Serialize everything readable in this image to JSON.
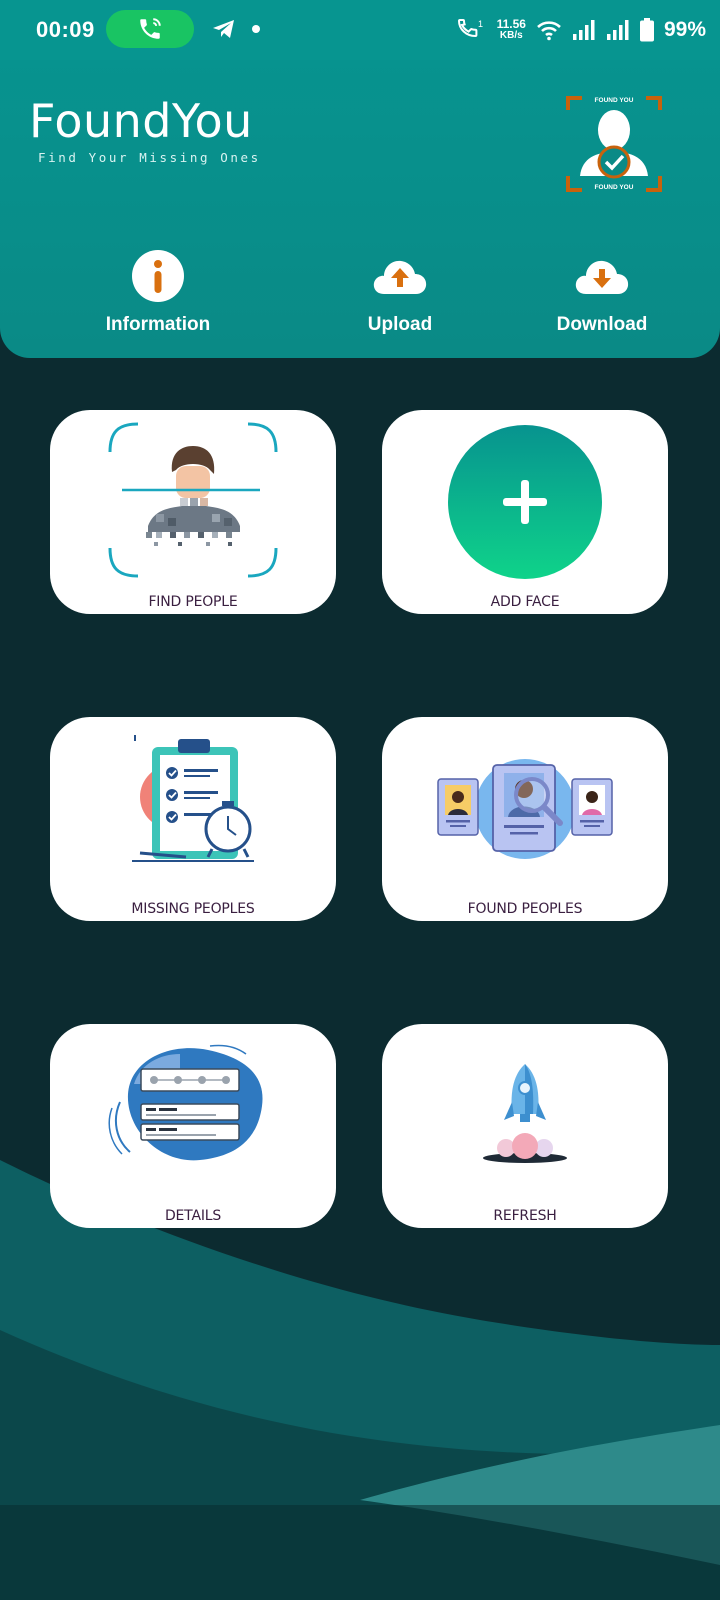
{
  "status_bar": {
    "time": "00:09",
    "net_speed_value": "11.56",
    "net_speed_unit": "KB/s",
    "battery": "99%"
  },
  "header": {
    "title": "FoundYou",
    "subtitle": "Find Your Missing Ones",
    "logo_text_top": "FOUND YOU",
    "logo_text_bottom": "FOUND YOU"
  },
  "actions": [
    {
      "label": "Information",
      "icon": "info-icon"
    },
    {
      "label": "Upload",
      "icon": "cloud-upload-icon"
    },
    {
      "label": "Download",
      "icon": "cloud-download-icon"
    }
  ],
  "cards": [
    {
      "label": "FIND PEOPLE",
      "icon": "face-scan-illustration"
    },
    {
      "label": "ADD FACE",
      "icon": "plus-icon"
    },
    {
      "label": "MISSING PEOPLES",
      "icon": "checklist-clock-illustration"
    },
    {
      "label": "FOUND PEOPLES",
      "icon": "profile-search-illustration"
    },
    {
      "label": "DETAILS",
      "icon": "details-list-illustration"
    },
    {
      "label": "REFRESH",
      "icon": "rocket-illustration"
    }
  ],
  "colors": {
    "primary": "#079590",
    "accent_orange": "#d9700f",
    "background": "#0d2a2e",
    "add_gradient_top": "#07938f",
    "add_gradient_bottom": "#0fd38a"
  }
}
